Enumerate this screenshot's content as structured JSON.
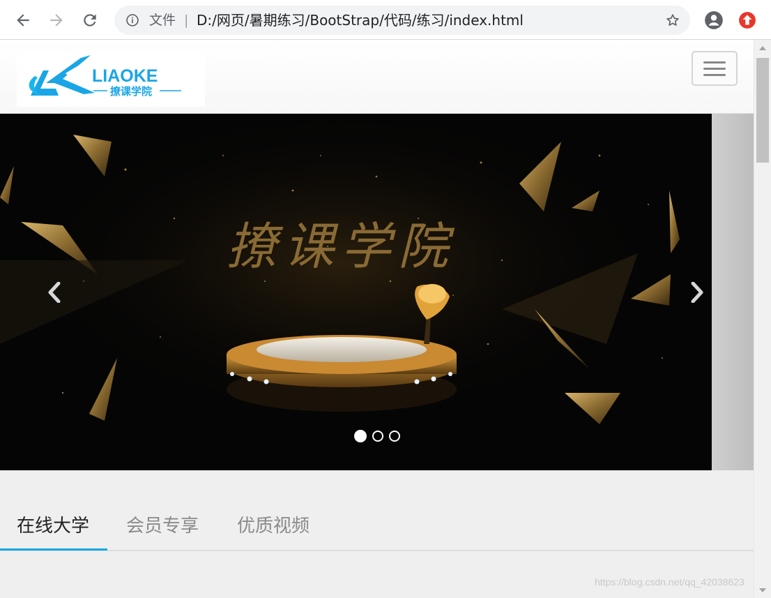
{
  "browser": {
    "scheme_label": "文件",
    "separator": "|",
    "url": "D:/网页/暑期练习/BootStrap/代码/练习/index.html"
  },
  "page": {
    "brand": {
      "name": "LIAOKE",
      "tagline": "撩课学院",
      "color": "#1aa5e6"
    },
    "banner": {
      "title": "撩课学院"
    },
    "carousel": {
      "slide_count": 3,
      "active_index": 0
    },
    "tabs": [
      {
        "label": "在线大学",
        "active": true
      },
      {
        "label": "会员专享",
        "active": false
      },
      {
        "label": "优质视频",
        "active": false
      }
    ],
    "accent_color": "#17a8e5"
  },
  "watermark": "https://blog.csdn.net/qq_42038623"
}
